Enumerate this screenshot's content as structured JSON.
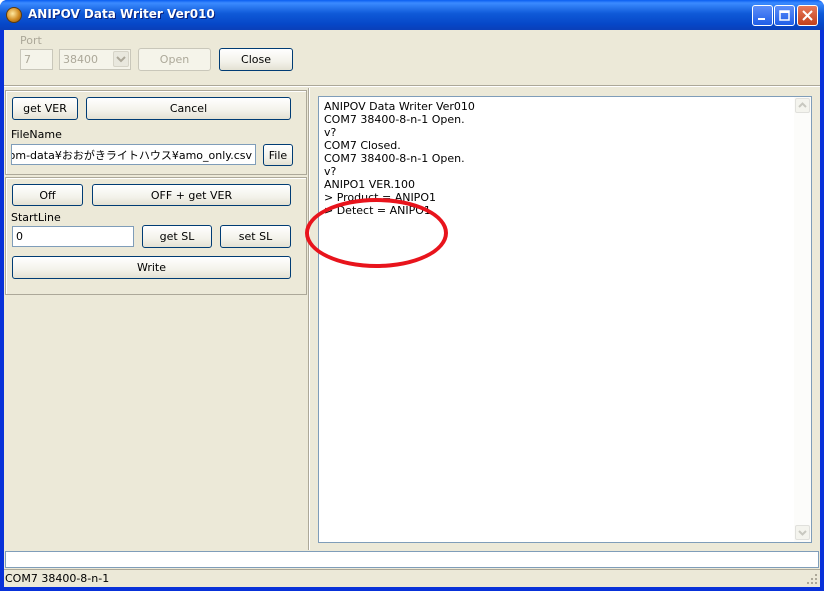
{
  "window": {
    "title": "ANIPOV Data Writer Ver010"
  },
  "port_panel": {
    "port_label": "Port",
    "port_value": "7",
    "baud_value": "38400",
    "open_label": "Open",
    "close_label": "Close"
  },
  "file_panel": {
    "get_ver_label": "get VER",
    "cancel_label": "Cancel",
    "filename_label": "FileName",
    "filename_value": "rgb¥rom-data¥おおがきライトハウス¥amo_only.csv",
    "file_button_label": "File"
  },
  "write_panel": {
    "off_label": "Off",
    "off_get_ver_label": "OFF + get VER",
    "startline_label": "StartLine",
    "startline_value": "0",
    "get_sl_label": "get SL",
    "set_sl_label": "set SL",
    "write_label": "Write"
  },
  "log": {
    "lines": [
      "ANIPOV Data Writer Ver010",
      "COM7 38400-8-n-1 Open.",
      "v?",
      "COM7 Closed.",
      "COM7 38400-8-n-1 Open.",
      "v?",
      "ANIPO1 VER.100",
      "> Product = ANIPO1",
      "> Detect = ANIPO1"
    ]
  },
  "status": {
    "text": "COM7 38400-8-n-1"
  },
  "colors": {
    "annotation": "#e8141c",
    "titlebar": "#0a5ef0",
    "client_bg": "#ece9d8"
  }
}
